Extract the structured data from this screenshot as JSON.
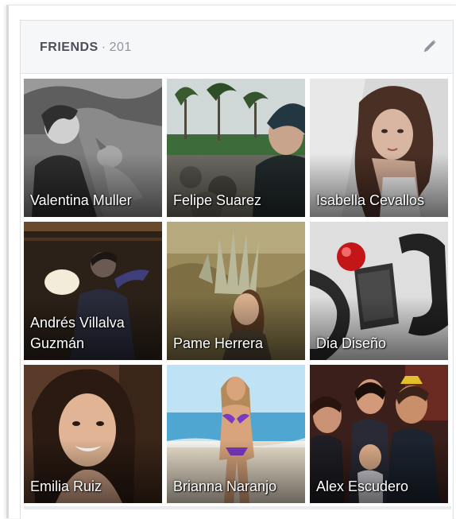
{
  "friends": {
    "title": "FRIENDS",
    "separator": "·",
    "count": "201",
    "edit_icon": "pencil-icon",
    "items": [
      {
        "name": "Valentina Muller"
      },
      {
        "name": "Felipe Suarez"
      },
      {
        "name": "Isabella Cevallos"
      },
      {
        "name": "Andrés Villalva Guzmán"
      },
      {
        "name": "Pame Herrera"
      },
      {
        "name": "Dia Diseño"
      },
      {
        "name": "Emilia Ruiz"
      },
      {
        "name": "Brianna Naranjo"
      },
      {
        "name": "Alex Escudero"
      }
    ]
  },
  "colors": {
    "header_bg": "#f6f7f9",
    "title_text": "#4b4f56",
    "count_text": "#90949c",
    "name_text": "#ffffff"
  }
}
